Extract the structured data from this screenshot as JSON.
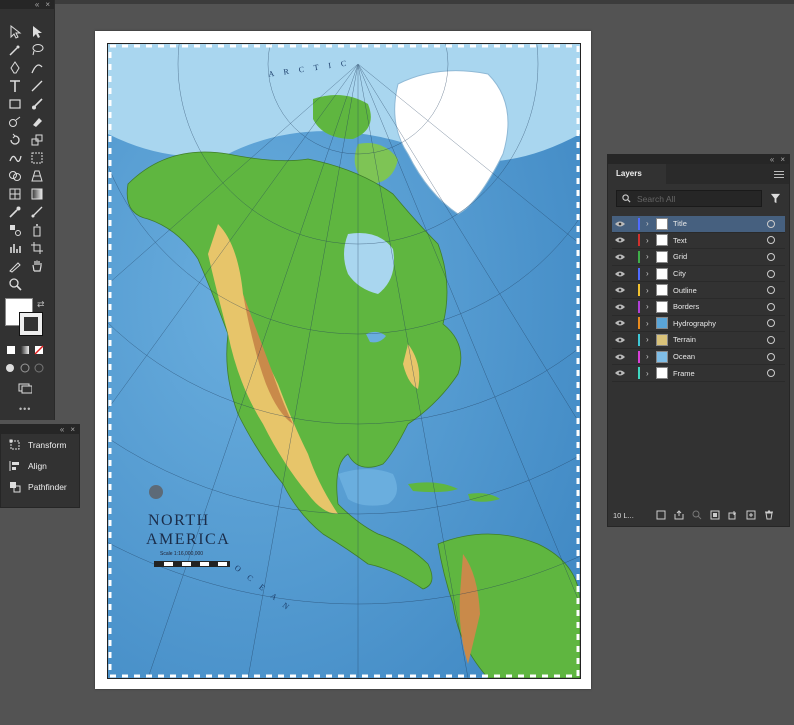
{
  "tools_panel": {
    "collapse_glyph": "«",
    "close_glyph": "×",
    "more_glyph": "•••"
  },
  "props_panel": {
    "collapse_glyph": "«",
    "close_glyph": "×",
    "items": [
      {
        "label": "Transform",
        "icon": "transform-icon"
      },
      {
        "label": "Align",
        "icon": "align-icon"
      },
      {
        "label": "Pathfinder",
        "icon": "pathfinder-icon"
      }
    ]
  },
  "map": {
    "title_line1": "NORTH",
    "title_line2": "AMERICA",
    "scale_text": "Scale 1:16,000,000",
    "ocean_label": "O C E A N",
    "arctic_label": "A R C T I C",
    "colors": {
      "ocean_deep": "#3d86c2",
      "ocean_mid": "#6aaede",
      "shelf": "#a9d6ef",
      "ice": "#ffffff",
      "lowland": "#5fb640",
      "upland": "#e7c56a",
      "mountain": "#c98a4a"
    }
  },
  "layers_panel": {
    "tab_label": "Layers",
    "collapse_glyph": "«",
    "close_glyph": "×",
    "search_placeholder": "Search All",
    "footer_count": "10 L...",
    "layers": [
      {
        "name": "Title",
        "color": "#4f6bff",
        "selected": true
      },
      {
        "name": "Text",
        "color": "#d0312d",
        "selected": false
      },
      {
        "name": "Grid",
        "color": "#3fae49",
        "selected": false
      },
      {
        "name": "City",
        "color": "#4f6bff",
        "selected": false
      },
      {
        "name": "Outline",
        "color": "#f2c230",
        "selected": false
      },
      {
        "name": "Borders",
        "color": "#b13fd6",
        "selected": false
      },
      {
        "name": "Hydrography",
        "color": "#e88a1e",
        "selected": false
      },
      {
        "name": "Terrain",
        "color": "#3fc7d6",
        "selected": false
      },
      {
        "name": "Ocean",
        "color": "#d83fd6",
        "selected": false
      },
      {
        "name": "Frame",
        "color": "#3fd6c0",
        "selected": false
      }
    ]
  }
}
